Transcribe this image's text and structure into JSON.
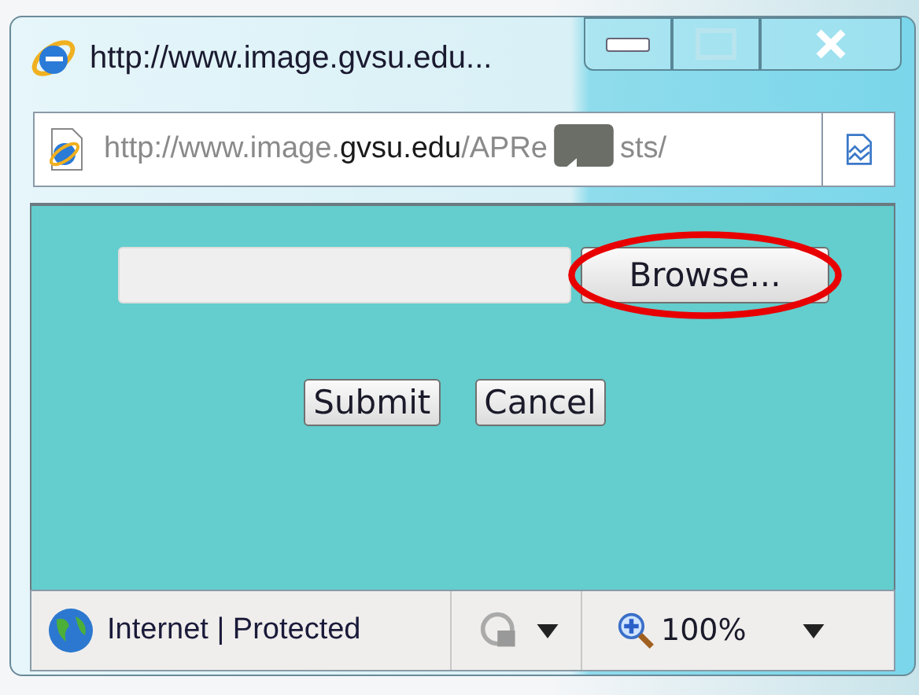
{
  "window": {
    "title": "http://www.image.gvsu.edu..."
  },
  "address_bar": {
    "segments": [
      {
        "text": "http://www.image.",
        "kind": "dim"
      },
      {
        "text": "gvsu.edu",
        "kind": "domain"
      },
      {
        "text": "/APRe",
        "kind": "dim"
      },
      {
        "text": "sts/",
        "kind": "dim"
      }
    ]
  },
  "form": {
    "browse_button": "Browse...",
    "buttons": [
      "Submit",
      "Cancel"
    ]
  },
  "status_bar": {
    "zone": "Internet | Protected",
    "zoom": "100%"
  }
}
